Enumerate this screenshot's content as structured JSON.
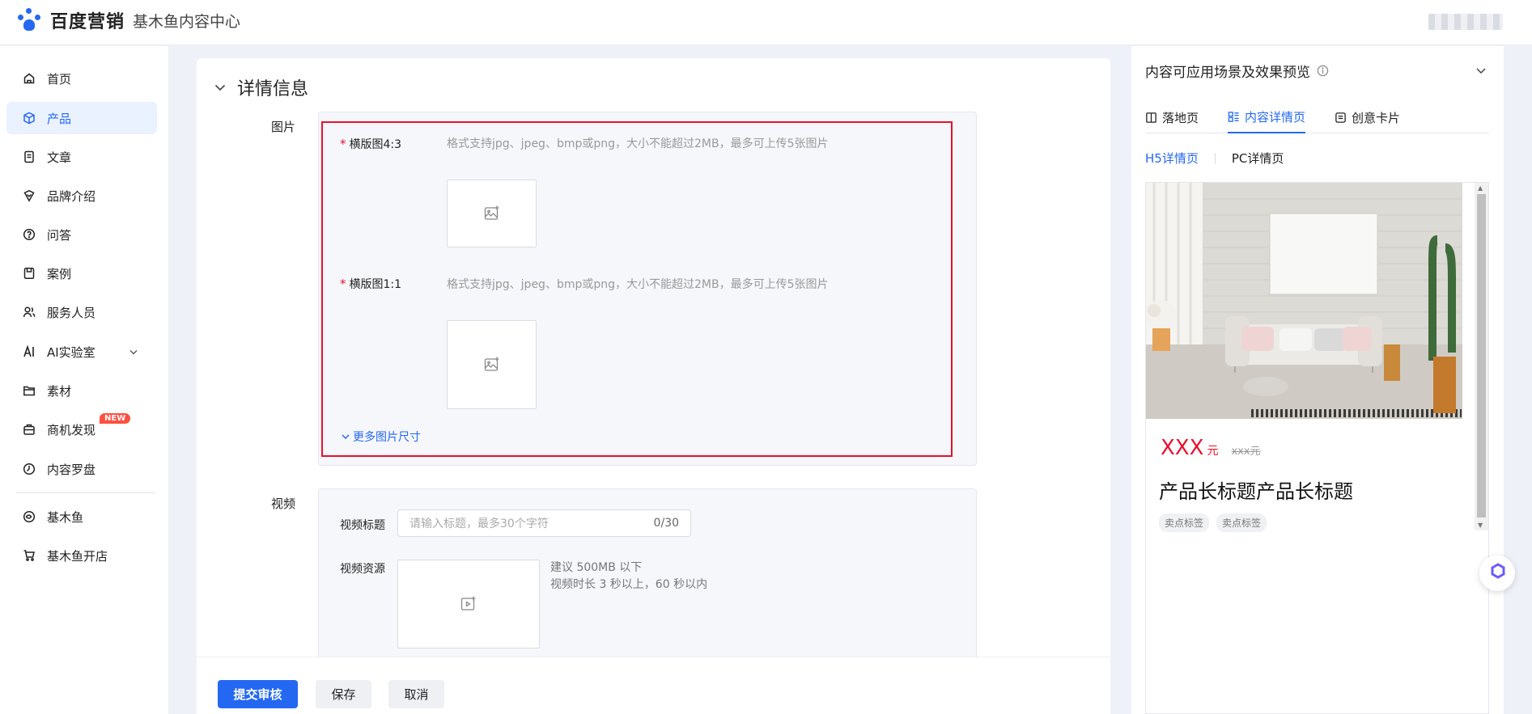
{
  "header": {
    "brand": "百度营销",
    "subtitle": "基木鱼内容中心"
  },
  "sidebar": {
    "items": [
      {
        "label": "首页",
        "icon": "home-icon"
      },
      {
        "label": "产品",
        "icon": "box-icon",
        "active": true
      },
      {
        "label": "文章",
        "icon": "document-icon"
      },
      {
        "label": "品牌介绍",
        "icon": "shield-icon"
      },
      {
        "label": "问答",
        "icon": "question-icon"
      },
      {
        "label": "案例",
        "icon": "save-icon"
      },
      {
        "label": "服务人员",
        "icon": "users-icon"
      },
      {
        "label": "AI实验室",
        "icon": "ai-icon"
      },
      {
        "label": "素材",
        "icon": "folder-icon"
      },
      {
        "label": "商机发现",
        "icon": "briefcase-icon",
        "badge": "NEW"
      },
      {
        "label": "内容罗盘",
        "icon": "compass-icon"
      },
      {
        "label": "基木鱼",
        "icon": "fish-icon"
      },
      {
        "label": "基木鱼开店",
        "icon": "store-icon"
      }
    ]
  },
  "main": {
    "section_title": "详情信息",
    "image_label": "图片",
    "image_fields": [
      {
        "label": "横版图4:3",
        "hint": "格式支持jpg、jpeg、bmp或png，大小不能超过2MB，最多可上传5张图片"
      },
      {
        "label": "横版图1:1",
        "hint": "格式支持jpg、jpeg、bmp或png，大小不能超过2MB，最多可上传5张图片"
      }
    ],
    "required_mark": "*",
    "more_sizes": "更多图片尺寸",
    "video_label": "视频",
    "video_title_label": "视频标题",
    "video_title_placeholder": "请输入标题，最多30个字符",
    "video_title_counter": "0/30",
    "video_resource_label": "视频资源",
    "video_hint_1": "建议 500MB 以下",
    "video_hint_2": "视频时长 3 秒以上，60 秒以内"
  },
  "footer": {
    "submit": "提交审核",
    "save": "保存",
    "cancel": "取消"
  },
  "preview": {
    "title": "内容可应用场景及效果预览",
    "tabs": [
      "落地页",
      "内容详情页",
      "创意卡片"
    ],
    "active_tab": "内容详情页",
    "subtabs": [
      "H5详情页",
      "PC详情页"
    ],
    "active_subtab": "H5详情页",
    "price": "XXX",
    "price_unit": "元",
    "price_original": "xxx元",
    "product_title": "产品长标题产品长标题",
    "tags": [
      "卖点标签",
      "卖点标签"
    ]
  },
  "colors": {
    "accent": "#2468f2",
    "required": "#e8112d",
    "badge": "#ff4f3f"
  }
}
